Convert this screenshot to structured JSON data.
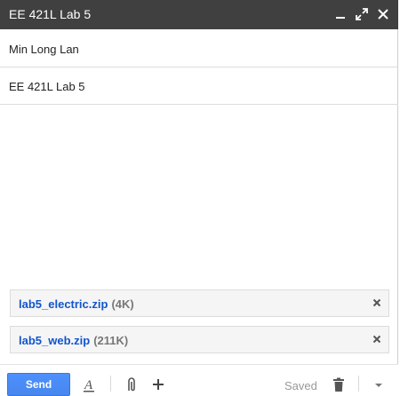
{
  "window": {
    "title": "EE 421L Lab 5",
    "controls": {
      "minimize": "minimize-icon",
      "popout": "expand-icon",
      "close": "close-icon"
    }
  },
  "compose": {
    "recipient": "Min Long Lan",
    "subject": "EE 421L Lab 5",
    "body": ""
  },
  "attachments": [
    {
      "name": "lab5_electric.zip",
      "size": "(4K)"
    },
    {
      "name": "lab5_web.zip",
      "size": "(211K)"
    }
  ],
  "toolbar": {
    "send_label": "Send",
    "saved_label": "Saved",
    "icons": [
      "formatting-icon",
      "attach-icon",
      "insert-more-icon",
      "trash-icon",
      "more-options-icon"
    ]
  },
  "colors": {
    "titlebar": "#404040",
    "send_button": "#4d90fe",
    "attachment_link": "#1155cc"
  }
}
